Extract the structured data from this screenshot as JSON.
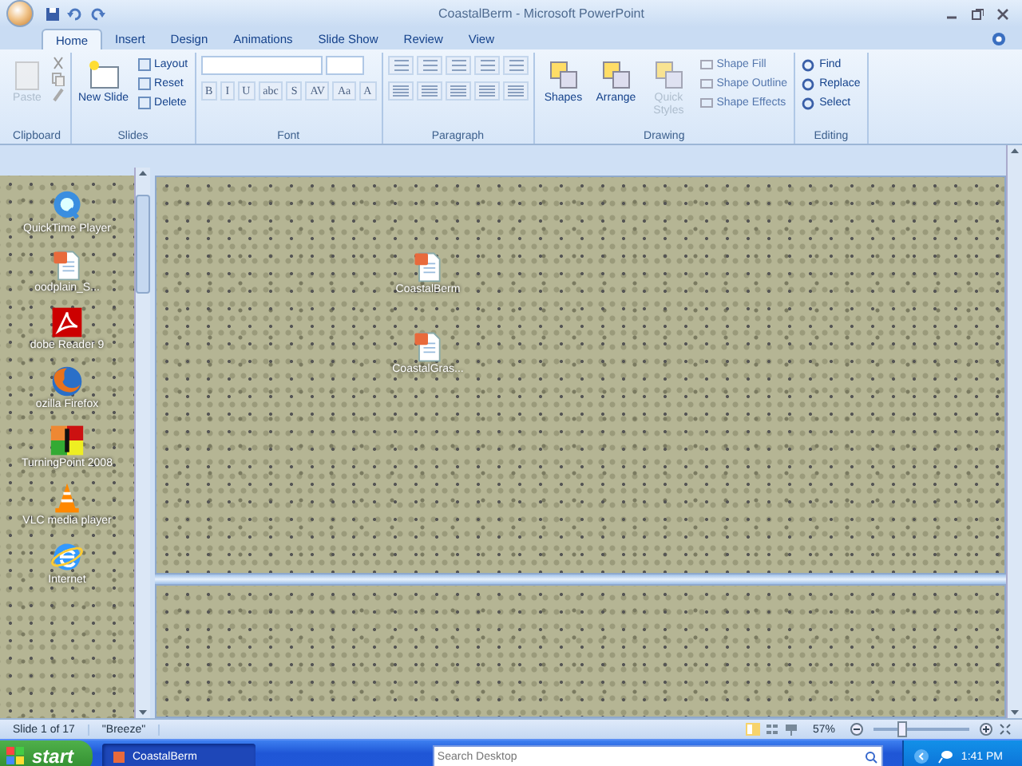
{
  "window": {
    "title": "CoastalBerm - Microsoft PowerPoint"
  },
  "tabs": [
    {
      "label": "Home",
      "selected": true
    },
    {
      "label": "Insert",
      "selected": false
    },
    {
      "label": "Design",
      "selected": false
    },
    {
      "label": "Animations",
      "selected": false
    },
    {
      "label": "Slide Show",
      "selected": false
    },
    {
      "label": "Review",
      "selected": false
    },
    {
      "label": "View",
      "selected": false
    }
  ],
  "ribbon": {
    "clipboard": {
      "label": "Clipboard",
      "paste": {
        "label": "Paste",
        "disabled": true
      }
    },
    "slides": {
      "label": "Slides",
      "new_slide": "New Slide",
      "items": [
        "Layout",
        "Reset",
        "Delete"
      ]
    },
    "font": {
      "label": "Font",
      "buttons": [
        "B",
        "I",
        "U",
        "abc",
        "S",
        "AV",
        "Aa",
        "A"
      ]
    },
    "paragraph": {
      "label": "Paragraph"
    },
    "drawing": {
      "label": "Drawing",
      "big": [
        {
          "label": "Shapes",
          "disabled": false
        },
        {
          "label": "Arrange",
          "disabled": false
        },
        {
          "label": "Quick Styles",
          "disabled": true
        }
      ],
      "small": [
        {
          "label": "Shape Fill",
          "disabled": true
        },
        {
          "label": "Shape Outline",
          "disabled": true
        },
        {
          "label": "Shape Effects",
          "disabled": true
        }
      ]
    },
    "editing": {
      "label": "Editing",
      "items": [
        "Find",
        "Replace",
        "Select"
      ]
    }
  },
  "desktop_icons": [
    {
      "label": "QuickTime Player",
      "kind": "media"
    },
    {
      "label": "oodplain_S...",
      "kind": "document"
    },
    {
      "label": "dobe Reader 9",
      "kind": "reader"
    },
    {
      "label": "ozilla Firefox",
      "kind": "browser"
    },
    {
      "label": "TurningPoint 2008",
      "kind": "clicker"
    },
    {
      "label": "VLC media player",
      "kind": "cone"
    },
    {
      "label": "Internet",
      "kind": "globe"
    }
  ],
  "slide_icons": [
    {
      "label": "CoastalBerm",
      "kind": "document"
    },
    {
      "label": "CoastalGras...",
      "kind": "document"
    }
  ],
  "status_bar": {
    "slide": "Slide 1 of 17",
    "theme": "\"Breeze\"",
    "zoom": "57%",
    "zoom_slider": {
      "level": 0.3
    }
  },
  "taskbar": {
    "start": "start",
    "tasks": [
      {
        "label": "CoastalBerm",
        "selected": true
      }
    ],
    "search": {
      "placeholder": "Search Desktop"
    },
    "clock": "1:41 PM"
  }
}
